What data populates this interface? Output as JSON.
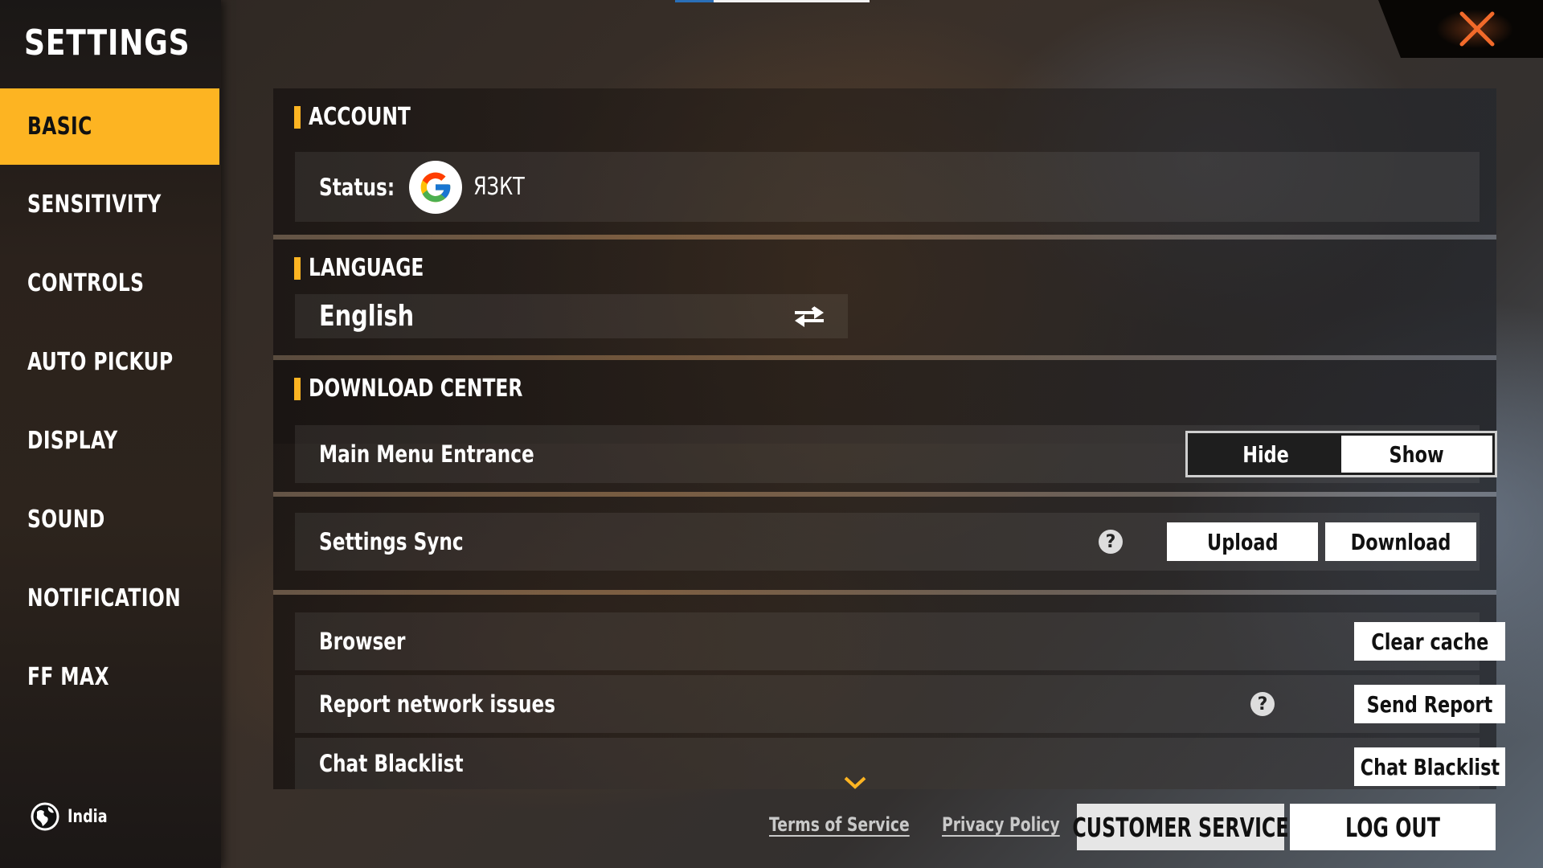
{
  "top_progress": {
    "value_percent": 20
  },
  "sidebar": {
    "title": "SETTINGS",
    "items": [
      {
        "label": "BASIC",
        "active": true
      },
      {
        "label": "SENSITIVITY",
        "active": false
      },
      {
        "label": "CONTROLS",
        "active": false
      },
      {
        "label": "AUTO PICKUP",
        "active": false
      },
      {
        "label": "DISPLAY",
        "active": false
      },
      {
        "label": "SOUND",
        "active": false
      },
      {
        "label": "NOTIFICATION",
        "active": false
      },
      {
        "label": "FF MAX",
        "active": false
      }
    ],
    "region": {
      "icon": "globe-icon",
      "label": "India"
    }
  },
  "close": {
    "icon": "close-icon",
    "color": "#f26a2a"
  },
  "account": {
    "title": "ACCOUNT",
    "status_label": "Status:",
    "provider_icon": "google-icon",
    "username": "ЯЗКТ"
  },
  "language": {
    "title": "LANGUAGE",
    "current": "English",
    "switch_icon": "swap-arrows-icon"
  },
  "download_center": {
    "title": "DOWNLOAD CENTER",
    "main_menu_entrance": {
      "label": "Main Menu Entrance",
      "options": [
        "Hide",
        "Show"
      ],
      "selected": "Show"
    }
  },
  "settings_sync": {
    "label": "Settings Sync",
    "help_icon": "?",
    "upload": "Upload",
    "download": "Download"
  },
  "misc": {
    "browser": {
      "label": "Browser",
      "button": "Clear cache"
    },
    "report": {
      "label": "Report network issues",
      "help_icon": "?",
      "button": "Send Report"
    },
    "blacklist": {
      "label": "Chat Blacklist",
      "button": "Chat Blacklist"
    }
  },
  "footer": {
    "terms": "Terms of Service",
    "privacy": "Privacy Policy",
    "customer_service": "CUSTOMER SERVICE",
    "logout": "LOG OUT"
  },
  "colors": {
    "accent": "#fdb422",
    "close": "#f26a2a",
    "button_bg": "#ffffff"
  }
}
